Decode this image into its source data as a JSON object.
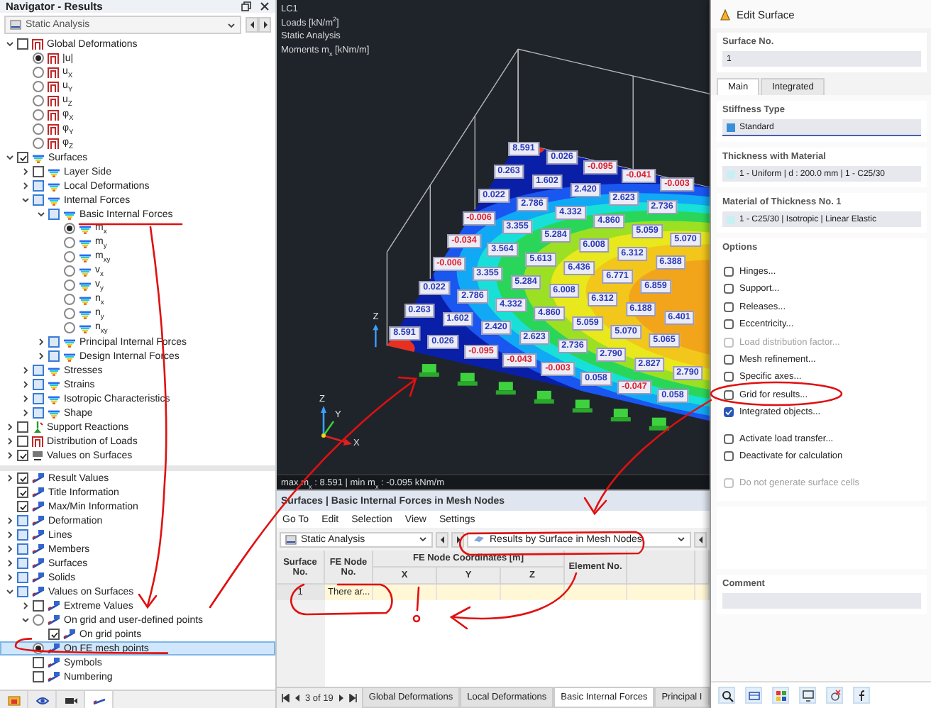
{
  "navigator": {
    "title": "Navigator - Results",
    "loadcase": "Static Analysis",
    "tree": [
      {
        "label": "Global Deformations",
        "kind": "deformation",
        "checked": false,
        "partial": false,
        "expanded": true,
        "children": [
          {
            "label": "|u|",
            "selected": true
          },
          {
            "label": "u$_{X}$",
            "selected": false
          },
          {
            "label": "u$_{Y}$",
            "selected": false
          },
          {
            "label": "u$_{Z}$",
            "selected": false
          },
          {
            "label": "φ$_{X}$",
            "selected": false
          },
          {
            "label": "φ$_{Y}$",
            "selected": false
          },
          {
            "label": "φ$_{Z}$",
            "selected": false
          }
        ]
      },
      {
        "label": "Surfaces",
        "kind": "contour",
        "checked": true,
        "partial": false,
        "expanded": true,
        "children": [
          {
            "label": "Layer Side",
            "checked": false,
            "partial": false,
            "expanded": false
          },
          {
            "label": "Local Deformations",
            "checked": false,
            "partial": true,
            "expanded": false
          },
          {
            "label": "Internal Forces",
            "checked": false,
            "partial": true,
            "expanded": true,
            "children": [
              {
                "label": "Basic Internal Forces",
                "checked": false,
                "partial": true,
                "expanded": true,
                "children": [
                  {
                    "label": "m$_{x}$",
                    "selected": true
                  },
                  {
                    "label": "m$_{y}$",
                    "selected": false
                  },
                  {
                    "label": "m$_{xy}$",
                    "selected": false
                  },
                  {
                    "label": "v$_{x}$",
                    "selected": false
                  },
                  {
                    "label": "v$_{y}$",
                    "selected": false
                  },
                  {
                    "label": "n$_{x}$",
                    "selected": false
                  },
                  {
                    "label": "n$_{y}$",
                    "selected": false
                  },
                  {
                    "label": "n$_{xy}$",
                    "selected": false
                  }
                ]
              },
              {
                "label": "Principal Internal Forces",
                "checked": false,
                "partial": true,
                "expanded": false
              },
              {
                "label": "Design Internal Forces",
                "checked": false,
                "partial": true,
                "expanded": false
              }
            ]
          },
          {
            "label": "Stresses",
            "checked": false,
            "partial": true,
            "expanded": false
          },
          {
            "label": "Strains",
            "checked": false,
            "partial": true,
            "expanded": false
          },
          {
            "label": "Isotropic Characteristics",
            "checked": false,
            "partial": true,
            "expanded": false
          },
          {
            "label": "Shape",
            "checked": false,
            "partial": true,
            "expanded": false
          }
        ]
      },
      {
        "label": "Support Reactions",
        "kind": "support",
        "checked": false,
        "partial": false,
        "expanded": false
      },
      {
        "label": "Distribution of Loads",
        "kind": "deformation",
        "checked": false,
        "partial": false,
        "expanded": false
      },
      {
        "label": "Values on Surfaces",
        "kind": "values",
        "checked": true,
        "partial": false,
        "expanded": false
      }
    ],
    "display_tree": [
      {
        "label": "Result Values",
        "kind": "display",
        "checked": true,
        "partial": false,
        "expanded": false
      },
      {
        "label": "Title Information",
        "kind": "display",
        "checked": true,
        "partial": false
      },
      {
        "label": "Max/Min Information",
        "kind": "display",
        "checked": true,
        "partial": false
      },
      {
        "label": "Deformation",
        "kind": "display",
        "checked": false,
        "partial": true,
        "expanded": false
      },
      {
        "label": "Lines",
        "kind": "display",
        "checked": false,
        "partial": true,
        "expanded": false
      },
      {
        "label": "Members",
        "kind": "display",
        "checked": false,
        "partial": true,
        "expanded": false
      },
      {
        "label": "Surfaces",
        "kind": "display",
        "checked": false,
        "partial": true,
        "expanded": false
      },
      {
        "label": "Solids",
        "kind": "display",
        "checked": false,
        "partial": true,
        "expanded": false
      },
      {
        "label": "Values on Surfaces",
        "kind": "display",
        "checked": false,
        "partial": true,
        "expanded": true,
        "children": [
          {
            "label": "Extreme Values",
            "checked": false,
            "partial": false,
            "expanded": false
          },
          {
            "label": "On grid and user-defined points",
            "selected": false,
            "expanded": true,
            "children": [
              {
                "label": "On grid points",
                "checked": true,
                "partial": false
              }
            ]
          },
          {
            "label": "On FE mesh points",
            "selected": true,
            "highlighted": true
          },
          {
            "label": "Symbols",
            "checked": false,
            "partial": false
          },
          {
            "label": "Numbering",
            "checked": false,
            "partial": false
          }
        ]
      }
    ],
    "bottom_tabs": [
      {
        "selected": false
      },
      {
        "selected": false
      },
      {
        "selected": false
      },
      {
        "selected": true
      }
    ]
  },
  "viewport": {
    "info": [
      "LC1",
      "Loads [kN/m$^{2}$]",
      "Static Analysis",
      "Moments m$_{x}$ [kNm/m]"
    ],
    "mesh_columns": [
      [
        {
          "value": "8.591",
          "negative": false
        },
        {
          "value": "0.263",
          "negative": false
        },
        {
          "value": "0.022",
          "negative": false
        },
        {
          "value": "-0.006",
          "negative": true
        },
        {
          "value": "-0.034",
          "negative": true
        },
        {
          "value": "-0.006",
          "negative": true
        },
        {
          "value": "0.022",
          "negative": false
        },
        {
          "value": "0.263",
          "negative": false
        },
        {
          "value": "8.591",
          "negative": false
        }
      ],
      [
        {
          "value": "0.026",
          "negative": false
        },
        {
          "value": "1.602",
          "negative": false
        },
        {
          "value": "2.786",
          "negative": false
        },
        {
          "value": "3.355",
          "negative": false
        },
        {
          "value": "3.564",
          "negative": false
        },
        {
          "value": "3.355",
          "negative": false
        },
        {
          "value": "2.786",
          "negative": false
        },
        {
          "value": "1.602",
          "negative": false
        },
        {
          "value": "0.026",
          "negative": false
        }
      ],
      [
        {
          "value": "-0.095",
          "negative": true
        },
        {
          "value": "2.420",
          "negative": false
        },
        {
          "value": "4.332",
          "negative": false
        },
        {
          "value": "5.284",
          "negative": false
        },
        {
          "value": "5.613",
          "negative": false
        },
        {
          "value": "5.284",
          "negative": false
        },
        {
          "value": "4.332",
          "negative": false
        },
        {
          "value": "2.420",
          "negative": false
        },
        {
          "value": "-0.095",
          "negative": true
        }
      ],
      [
        {
          "value": "-0.041",
          "negative": true
        },
        {
          "value": "2.623",
          "negative": false
        },
        {
          "value": "4.860",
          "negative": false
        },
        {
          "value": "6.008",
          "negative": false
        },
        {
          "value": "6.436",
          "negative": false
        },
        {
          "value": "6.008",
          "negative": false
        },
        {
          "value": "4.860",
          "negative": false
        },
        {
          "value": "2.623",
          "negative": false
        },
        {
          "value": "-0.043",
          "negative": true
        }
      ],
      [
        {
          "value": "-0.003",
          "negative": true
        },
        {
          "value": "2.736",
          "negative": false
        },
        {
          "value": "5.059",
          "negative": false
        },
        {
          "value": "6.312",
          "negative": false
        },
        {
          "value": "6.771",
          "negative": false
        },
        {
          "value": "6.312",
          "negative": false
        },
        {
          "value": "5.059",
          "negative": false
        },
        {
          "value": "2.736",
          "negative": false
        },
        {
          "value": "-0.003",
          "negative": true
        }
      ],
      [
        null,
        null,
        {
          "value": "5.070",
          "negative": false
        },
        {
          "value": "6.388",
          "negative": false
        },
        {
          "value": "6.859",
          "negative": false
        },
        {
          "value": "6.188",
          "negative": false
        },
        {
          "value": "5.070",
          "negative": false
        },
        {
          "value": "2.790",
          "negative": false
        },
        {
          "value": "0.058",
          "negative": false
        }
      ],
      [
        null,
        null,
        null,
        null,
        null,
        {
          "value": "6.401",
          "negative": false
        },
        {
          "value": "5.065",
          "negative": false
        },
        {
          "value": "2.827",
          "negative": false
        },
        {
          "value": "-0.047",
          "negative": true
        }
      ],
      [
        null,
        null,
        null,
        null,
        null,
        null,
        null,
        {
          "value": "2.790",
          "negative": false
        },
        {
          "value": "0.058",
          "negative": false
        }
      ]
    ],
    "axis_labels": [
      "Z",
      "Y",
      "X"
    ],
    "corner_axis_label": "Z",
    "summary": "max m$_{x}$ : 8.591 | min m$_{x}$ : -0.095 kNm/m"
  },
  "table": {
    "title": "Surfaces | Basic Internal Forces in Mesh Nodes",
    "menu": [
      "Go To",
      "Edit",
      "Selection",
      "View",
      "Settings"
    ],
    "loadcase": "Static Analysis",
    "result_type": "Results by Surface in Mesh Nodes",
    "group_header": "FE Node Coordinates [m]",
    "columns": [
      {
        "label": "Surface No.",
        "grouped": false
      },
      {
        "label": "FE Node No.",
        "grouped": false
      },
      {
        "label": "X",
        "grouped": true
      },
      {
        "label": "Y",
        "grouped": true
      },
      {
        "label": "Z",
        "grouped": true
      },
      {
        "label": "Element No.",
        "grouped": false
      }
    ],
    "rows": [
      [
        "1",
        "There ar..."
      ]
    ],
    "pager": "3 of 19",
    "tabs": [
      {
        "label": "Global Deformations",
        "selected": false
      },
      {
        "label": "Local Deformations",
        "selected": false
      },
      {
        "label": "Basic Internal Forces",
        "selected": true
      },
      {
        "label": "Principal I",
        "selected": false
      }
    ]
  },
  "dialog": {
    "title": "Edit Surface",
    "number_label": "Surface No.",
    "number": "1",
    "tabs": [
      {
        "label": "Main",
        "selected": true
      },
      {
        "label": "Integrated",
        "selected": false
      }
    ],
    "fields": [
      {
        "label": "Stiffness Type",
        "value": "Standard",
        "color": "#3a8fd8"
      },
      {
        "label": "Thickness with Material",
        "value": "1 - Uniform | d : 200.0 mm | 1 - C25/30",
        "color": "#c8f0f4"
      },
      {
        "label": "Material of Thickness No. 1",
        "value": "1 - C25/30 | Isotropic | Linear Elastic",
        "color": "#c8f0f4"
      }
    ],
    "options_label": "Options",
    "options": [
      [
        {
          "label": "Hinges...",
          "checked": false,
          "disabled": false
        },
        {
          "label": "Support...",
          "checked": false,
          "disabled": false
        },
        {
          "label": "Releases...",
          "checked": false,
          "disabled": false
        },
        {
          "label": "Eccentricity...",
          "checked": false,
          "disabled": false
        },
        {
          "label": "Load distribution factor...",
          "checked": false,
          "disabled": true
        },
        {
          "label": "Mesh refinement...",
          "checked": false,
          "disabled": false
        },
        {
          "label": "Specific axes...",
          "checked": false,
          "disabled": false
        },
        {
          "label": "Grid for results...",
          "checked": false,
          "disabled": false
        },
        {
          "label": "Integrated objects...",
          "checked": true,
          "disabled": false
        }
      ],
      [
        {
          "label": "Activate load transfer...",
          "checked": false,
          "disabled": false
        },
        {
          "label": "Deactivate for calculation",
          "checked": false,
          "disabled": false
        }
      ],
      [
        {
          "label": "Do not generate surface cells",
          "checked": false,
          "disabled": true
        }
      ]
    ],
    "comment_label": "Comment"
  }
}
